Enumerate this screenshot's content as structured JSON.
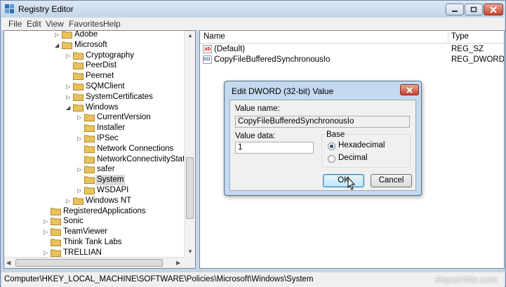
{
  "window": {
    "title": "Registry Editor",
    "buttons": {
      "minimize": "minimize",
      "maximize": "maximize",
      "close": "close"
    }
  },
  "menu": [
    "File",
    "Edit",
    "View",
    "Favorites",
    "Help"
  ],
  "tree": {
    "items": [
      {
        "label": "Adobe",
        "expander": "▷",
        "level": 1
      },
      {
        "label": "Microsoft",
        "expander": "◢",
        "level": 1
      },
      {
        "label": "Cryptography",
        "expander": "▷",
        "level": 2
      },
      {
        "label": "PeerDist",
        "expander": "",
        "level": 2
      },
      {
        "label": "Peernet",
        "expander": "",
        "level": 2
      },
      {
        "label": "SQMClient",
        "expander": "▷",
        "level": 2
      },
      {
        "label": "SystemCertificates",
        "expander": "▷",
        "level": 2
      },
      {
        "label": "Windows",
        "expander": "◢",
        "level": 2
      },
      {
        "label": "CurrentVersion",
        "expander": "▷",
        "level": 3
      },
      {
        "label": "Installer",
        "expander": "",
        "level": 3
      },
      {
        "label": "IPSec",
        "expander": "▷",
        "level": 3
      },
      {
        "label": "Network Connections",
        "expander": "",
        "level": 3
      },
      {
        "label": "NetworkConnectivityStatusIn",
        "expander": "",
        "level": 3
      },
      {
        "label": "safer",
        "expander": "▷",
        "level": 3
      },
      {
        "label": "System",
        "expander": "",
        "level": 3,
        "selected": true
      },
      {
        "label": "WSDAPI",
        "expander": "▷",
        "level": 3
      },
      {
        "label": "Windows NT",
        "expander": "▷",
        "level": 2
      },
      {
        "label": "RegisteredApplications",
        "expander": "",
        "level": 0
      },
      {
        "label": "Sonic",
        "expander": "▷",
        "level": 0
      },
      {
        "label": "TeamViewer",
        "expander": "▷",
        "level": 0
      },
      {
        "label": "Think Tank Labs",
        "expander": "",
        "level": 0
      },
      {
        "label": "TRELLIAN",
        "expander": "▷",
        "level": 0
      }
    ]
  },
  "list": {
    "columns": {
      "name": "Name",
      "type": "Type"
    },
    "rows": [
      {
        "icon": "ab",
        "name": "(Default)",
        "type": "REG_SZ"
      },
      {
        "icon": "011",
        "name": "CopyFileBufferedSynchronousIo",
        "type": "REG_DWORD"
      }
    ]
  },
  "status": {
    "path": "Computer\\HKEY_LOCAL_MACHINE\\SOFTWARE\\Policies\\Microsoft\\Windows\\System",
    "watermark": "RepairWin.com"
  },
  "dialog": {
    "title": "Edit DWORD (32-bit) Value",
    "value_name_label": "Value name:",
    "value_name": "CopyFileBufferedSynchronousIo",
    "value_data_label": "Value data:",
    "value_data": "1",
    "base_label": "Base",
    "hex_label": "Hexadecimal",
    "dec_label": "Decimal",
    "base_selected": "Hexadecimal",
    "ok_label": "OK",
    "cancel_label": "Cancel"
  },
  "colors": {
    "selection": "#cce8ff",
    "title_bg": "#c4d6ea",
    "folder": "#e8c25c"
  }
}
